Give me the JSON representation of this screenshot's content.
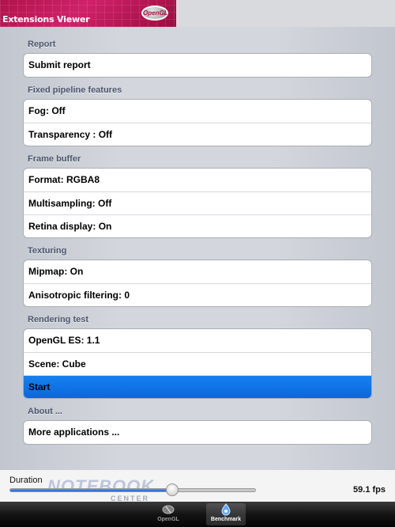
{
  "header": {
    "title": "Extensions Viewer",
    "logo_text": "OpenGL"
  },
  "sections": [
    {
      "heading": "Report",
      "rows": [
        "Submit report"
      ]
    },
    {
      "heading": "Fixed pipeline features",
      "rows": [
        "Fog: Off",
        "Transparency : Off"
      ]
    },
    {
      "heading": "Frame buffer",
      "rows": [
        "Format: RGBA8",
        "Multisampling: Off",
        "Retina display: On"
      ]
    },
    {
      "heading": "Texturing",
      "rows": [
        "Mipmap: On",
        "Anisotropic filtering: 0"
      ]
    },
    {
      "heading": "Rendering test",
      "rows": [
        "OpenGL ES: 1.1",
        "Scene: Cube",
        "Start"
      ]
    },
    {
      "heading": "About ...",
      "rows": [
        "More applications ..."
      ]
    }
  ],
  "selected_row": "Start",
  "bottom": {
    "duration_label": "Duration",
    "duration_fraction": 0.66,
    "fps": "59.1 fps"
  },
  "watermark": {
    "text": "NOTEBOOK",
    "sub": "CENTER"
  },
  "tabbar": {
    "tabs": [
      {
        "label": "OpenGL",
        "icon": "opengl-icon",
        "active": false
      },
      {
        "label": "Benchmark",
        "icon": "benchmark-icon",
        "active": true
      }
    ]
  },
  "colors": {
    "selected_row": "#0b67dd",
    "banner": "#b0134a"
  }
}
